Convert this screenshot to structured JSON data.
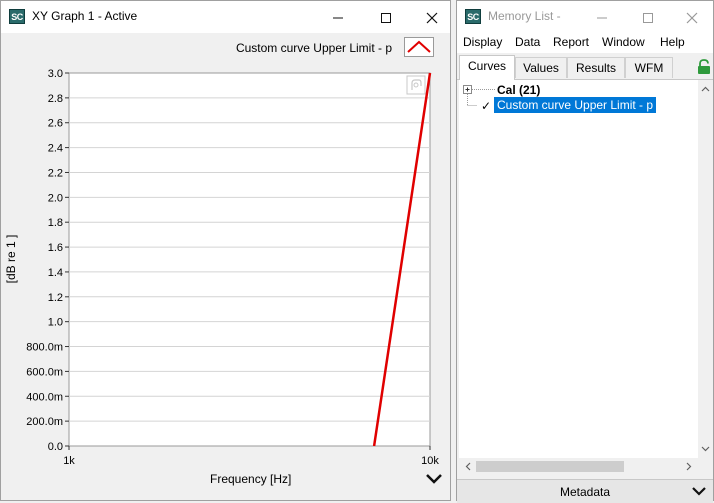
{
  "graph_window": {
    "logo": "SC",
    "title": "XY Graph 1 - Active",
    "legend_label": "Custom curve Upper Limit - p",
    "xlabel": "Frequency [Hz]",
    "ylabel": "[dB re 1 ]",
    "chart_data": {
      "type": "line",
      "x_scale": "log",
      "xlim": [
        1000,
        10000
      ],
      "ylim": [
        0.0,
        3.0
      ],
      "x_ticks": [
        "1k",
        "10k"
      ],
      "y_ticks": [
        "0.0",
        "200.0m",
        "400.0m",
        "600.0m",
        "800.0m",
        "1.0",
        "1.2",
        "1.4",
        "1.6",
        "1.8",
        "2.0",
        "2.2",
        "2.4",
        "2.6",
        "2.8",
        "3.0"
      ],
      "grid": true,
      "series": [
        {
          "name": "Custom curve Upper Limit - p",
          "color": "#e00000",
          "x": [
            7000,
            10000
          ],
          "y": [
            0.0,
            3.0
          ]
        }
      ]
    }
  },
  "memory_window": {
    "logo": "SC",
    "title": "Memory List -",
    "menu": [
      "Display",
      "Data",
      "Report",
      "Window",
      "Help"
    ],
    "tabs": [
      {
        "label": "Curves",
        "active": true
      },
      {
        "label": "Values",
        "active": false
      },
      {
        "label": "Results",
        "active": false
      },
      {
        "label": "WFM",
        "active": false
      }
    ],
    "tree": {
      "group_label": "Cal (21)",
      "item_check": "✓",
      "item_label": "Custom curve Upper Limit - p"
    },
    "metadata_label": "Metadata"
  }
}
